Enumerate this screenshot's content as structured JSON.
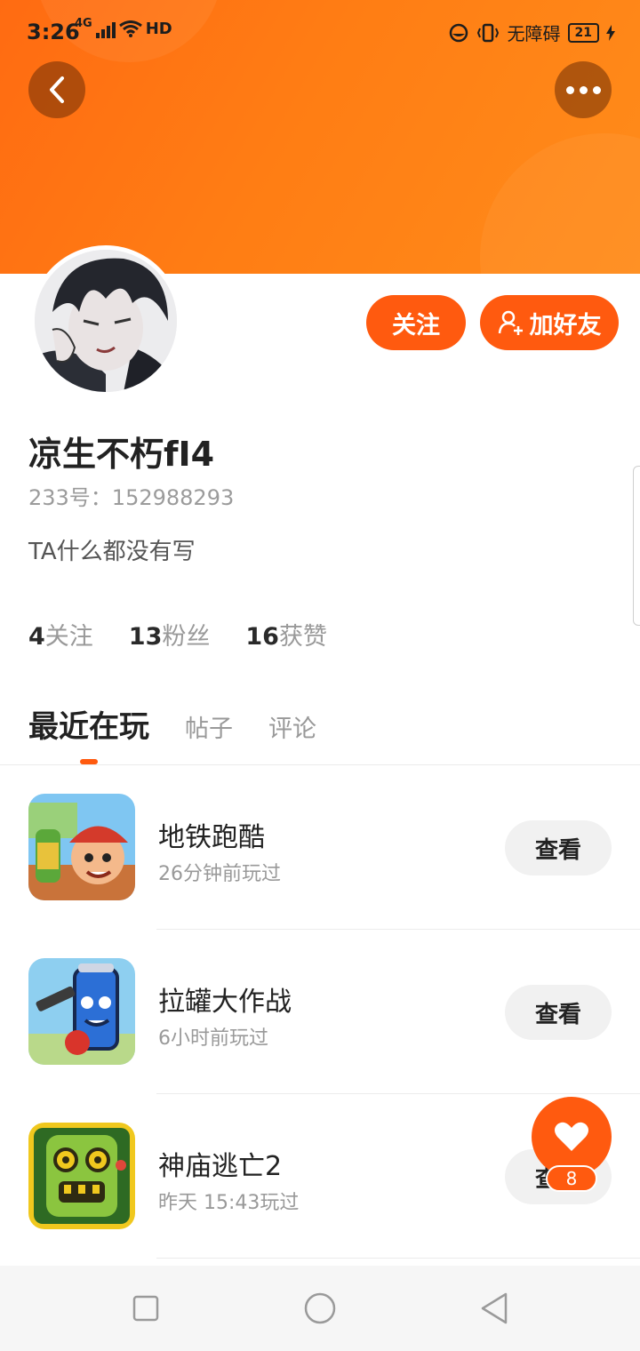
{
  "status_bar": {
    "time": "3:26",
    "network": "4G",
    "hd": "HD",
    "accessibility_label": "无障碍",
    "battery": "21"
  },
  "profile": {
    "username": "凉生不朽fI4",
    "user_id": "233号：152988293",
    "bio": "TA什么都没有写",
    "follow_label": "关注",
    "add_friend_label": "加好友"
  },
  "stats": [
    {
      "value": "4",
      "label": "关注"
    },
    {
      "value": "13",
      "label": "粉丝"
    },
    {
      "value": "16",
      "label": "获赞"
    }
  ],
  "tabs": [
    {
      "label": "最近在玩",
      "active": true
    },
    {
      "label": "帖子",
      "active": false
    },
    {
      "label": "评论",
      "active": false
    }
  ],
  "games": [
    {
      "name": "地铁跑酷",
      "played": "26分钟前玩过",
      "action": "查看",
      "icon": "subway-surfers-icon"
    },
    {
      "name": "拉罐大作战",
      "played": "6小时前玩过",
      "action": "查看",
      "icon": "can-battle-icon"
    },
    {
      "name": "神庙逃亡2",
      "played": "昨天 15:43玩过",
      "action": "查看",
      "icon": "temple-run-icon"
    }
  ],
  "like": {
    "count": "8"
  },
  "colors": {
    "accent": "#ff5a0f",
    "header_start": "#ff6b12",
    "header_end": "#ff8c1a"
  }
}
